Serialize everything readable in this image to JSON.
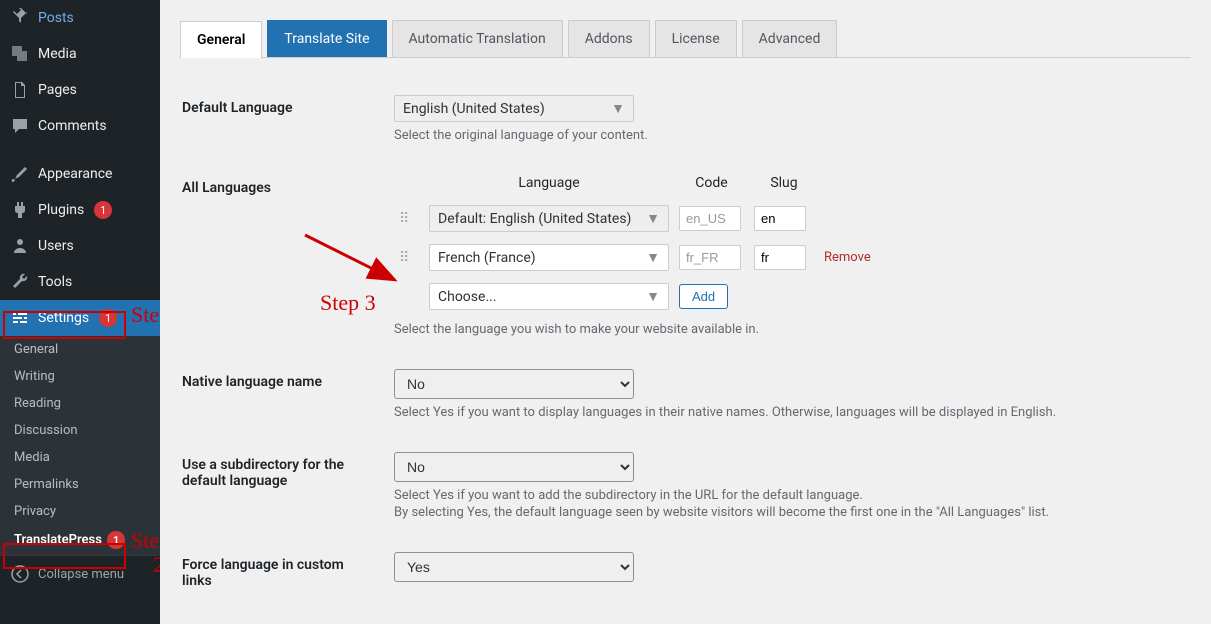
{
  "sidebar": {
    "items": [
      {
        "label": "Posts",
        "icon": "pin"
      },
      {
        "label": "Media",
        "icon": "media"
      },
      {
        "label": "Pages",
        "icon": "pages"
      },
      {
        "label": "Comments",
        "icon": "comment"
      },
      {
        "label": "Appearance",
        "icon": "brush"
      },
      {
        "label": "Plugins",
        "icon": "plug",
        "badge": 1
      },
      {
        "label": "Users",
        "icon": "user"
      },
      {
        "label": "Tools",
        "icon": "wrench"
      },
      {
        "label": "Settings",
        "icon": "sliders",
        "badge": 1
      }
    ],
    "submenu": [
      "General",
      "Writing",
      "Reading",
      "Discussion",
      "Media",
      "Permalinks",
      "Privacy",
      "TranslatePress"
    ],
    "submenu_badge": 1,
    "collapse": "Collapse menu"
  },
  "tabs": [
    "General",
    "Translate Site",
    "Automatic Translation",
    "Addons",
    "License",
    "Advanced"
  ],
  "form": {
    "default_language": {
      "label": "Default Language",
      "value": "English (United States)",
      "desc": "Select the original language of your content."
    },
    "all_languages": {
      "label": "All Languages",
      "headers": {
        "language": "Language",
        "code": "Code",
        "slug": "Slug"
      },
      "rows": [
        {
          "language": "Default: English (United States)",
          "code": "en_US",
          "slug": "en",
          "removable": false
        },
        {
          "language": "French (France)",
          "code": "fr_FR",
          "slug": "fr",
          "removable": true
        }
      ],
      "choose": "Choose...",
      "add": "Add",
      "remove": "Remove",
      "desc": "Select the language you wish to make your website available in."
    },
    "native": {
      "label": "Native language name",
      "value": "No",
      "desc": "Select Yes if you want to display languages in their native names. Otherwise, languages will be displayed in English."
    },
    "subdir": {
      "label": "Use a subdirectory for the default language",
      "value": "No",
      "desc1": "Select Yes if you want to add the subdirectory in the URL for the default language.",
      "desc2": "By selecting Yes, the default language seen by website visitors will become the first one in the \"All Languages\" list."
    },
    "force": {
      "label": "Force language in custom links",
      "value": "Yes"
    }
  },
  "annotations": {
    "step1": "Step",
    "step2": "Step",
    "step3": "Step 3",
    "step2num": "2"
  }
}
